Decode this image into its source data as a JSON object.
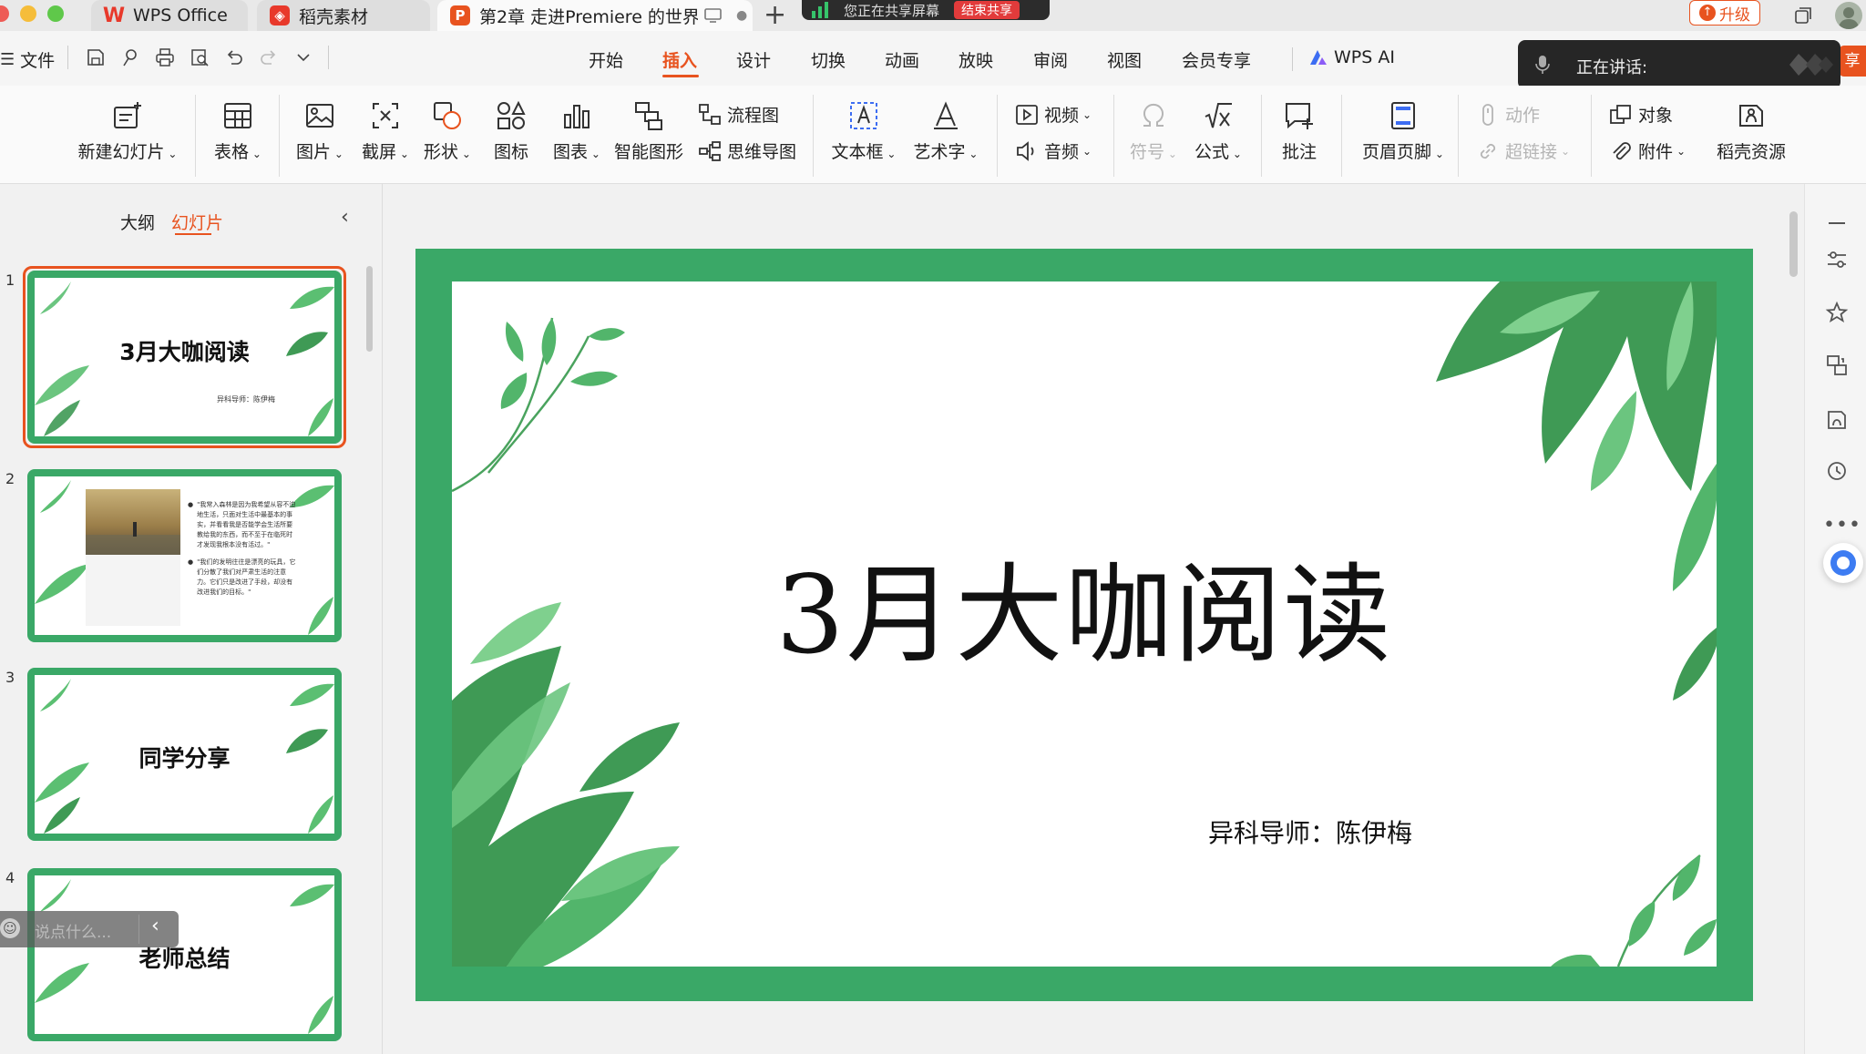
{
  "titlebar": {
    "tabs": [
      {
        "label": "WPS Office"
      },
      {
        "label": "稻壳素材"
      },
      {
        "label": "第2章   走进Premiere 的世界"
      }
    ],
    "share": {
      "status": "您正在共享屏幕",
      "end_label": "结束共享"
    },
    "upgrade_label": "升级"
  },
  "menubar": {
    "file_label": "文件",
    "tabs": [
      "开始",
      "插入",
      "设计",
      "切换",
      "动画",
      "放映",
      "审阅",
      "视图",
      "会员专享"
    ],
    "active_tab": "插入",
    "wps_ai": "WPS AI",
    "share_partial": "享"
  },
  "speaking": {
    "label": "正在讲话:"
  },
  "ribbon": {
    "new_slide": "新建幻灯片",
    "table": "表格",
    "picture": "图片",
    "screenshot": "截屏",
    "shape": "形状",
    "icon": "图标",
    "chart": "图表",
    "smart_graphic": "智能图形",
    "flowchart": "流程图",
    "mindmap": "思维导图",
    "textbox": "文本框",
    "wordart": "艺术字",
    "video": "视频",
    "audio": "音频",
    "symbol": "符号",
    "formula": "公式",
    "comment": "批注",
    "header_footer": "页眉页脚",
    "action": "动作",
    "hyperlink": "超链接",
    "object": "对象",
    "attachment": "附件",
    "docer_resources": "稻壳资源"
  },
  "leftpane": {
    "tab_outline": "大纲",
    "tab_slides": "幻灯片",
    "slides": [
      {
        "num": "1",
        "title": "3月大咖阅读",
        "subtitle": "异科导师：陈伊梅"
      },
      {
        "num": "2",
        "title": "",
        "bullets": [
          "\"我常入森林是因为我希望从容不迫地生活，只面对生活中最基本的事实，并看看我是否能学会生活所要教给我的东西，而不至于在临死时才发现我根本没有活过。\"",
          "\"我们的发明往往是漂亮的玩具，它们分散了我们对严肃生活的注意力。它们只是改进了手段，却没有改进我们的目标。\""
        ]
      },
      {
        "num": "3",
        "title": "同学分享"
      },
      {
        "num": "4",
        "title": "老师总结"
      }
    ]
  },
  "slide": {
    "title": "3月大咖阅读",
    "subtitle": "异科导师：陈伊梅"
  },
  "chat": {
    "placeholder": "说点什么..."
  },
  "colors": {
    "accent": "#e8531f",
    "slide_green": "#3aa867",
    "wps_red": "#e8392b"
  }
}
